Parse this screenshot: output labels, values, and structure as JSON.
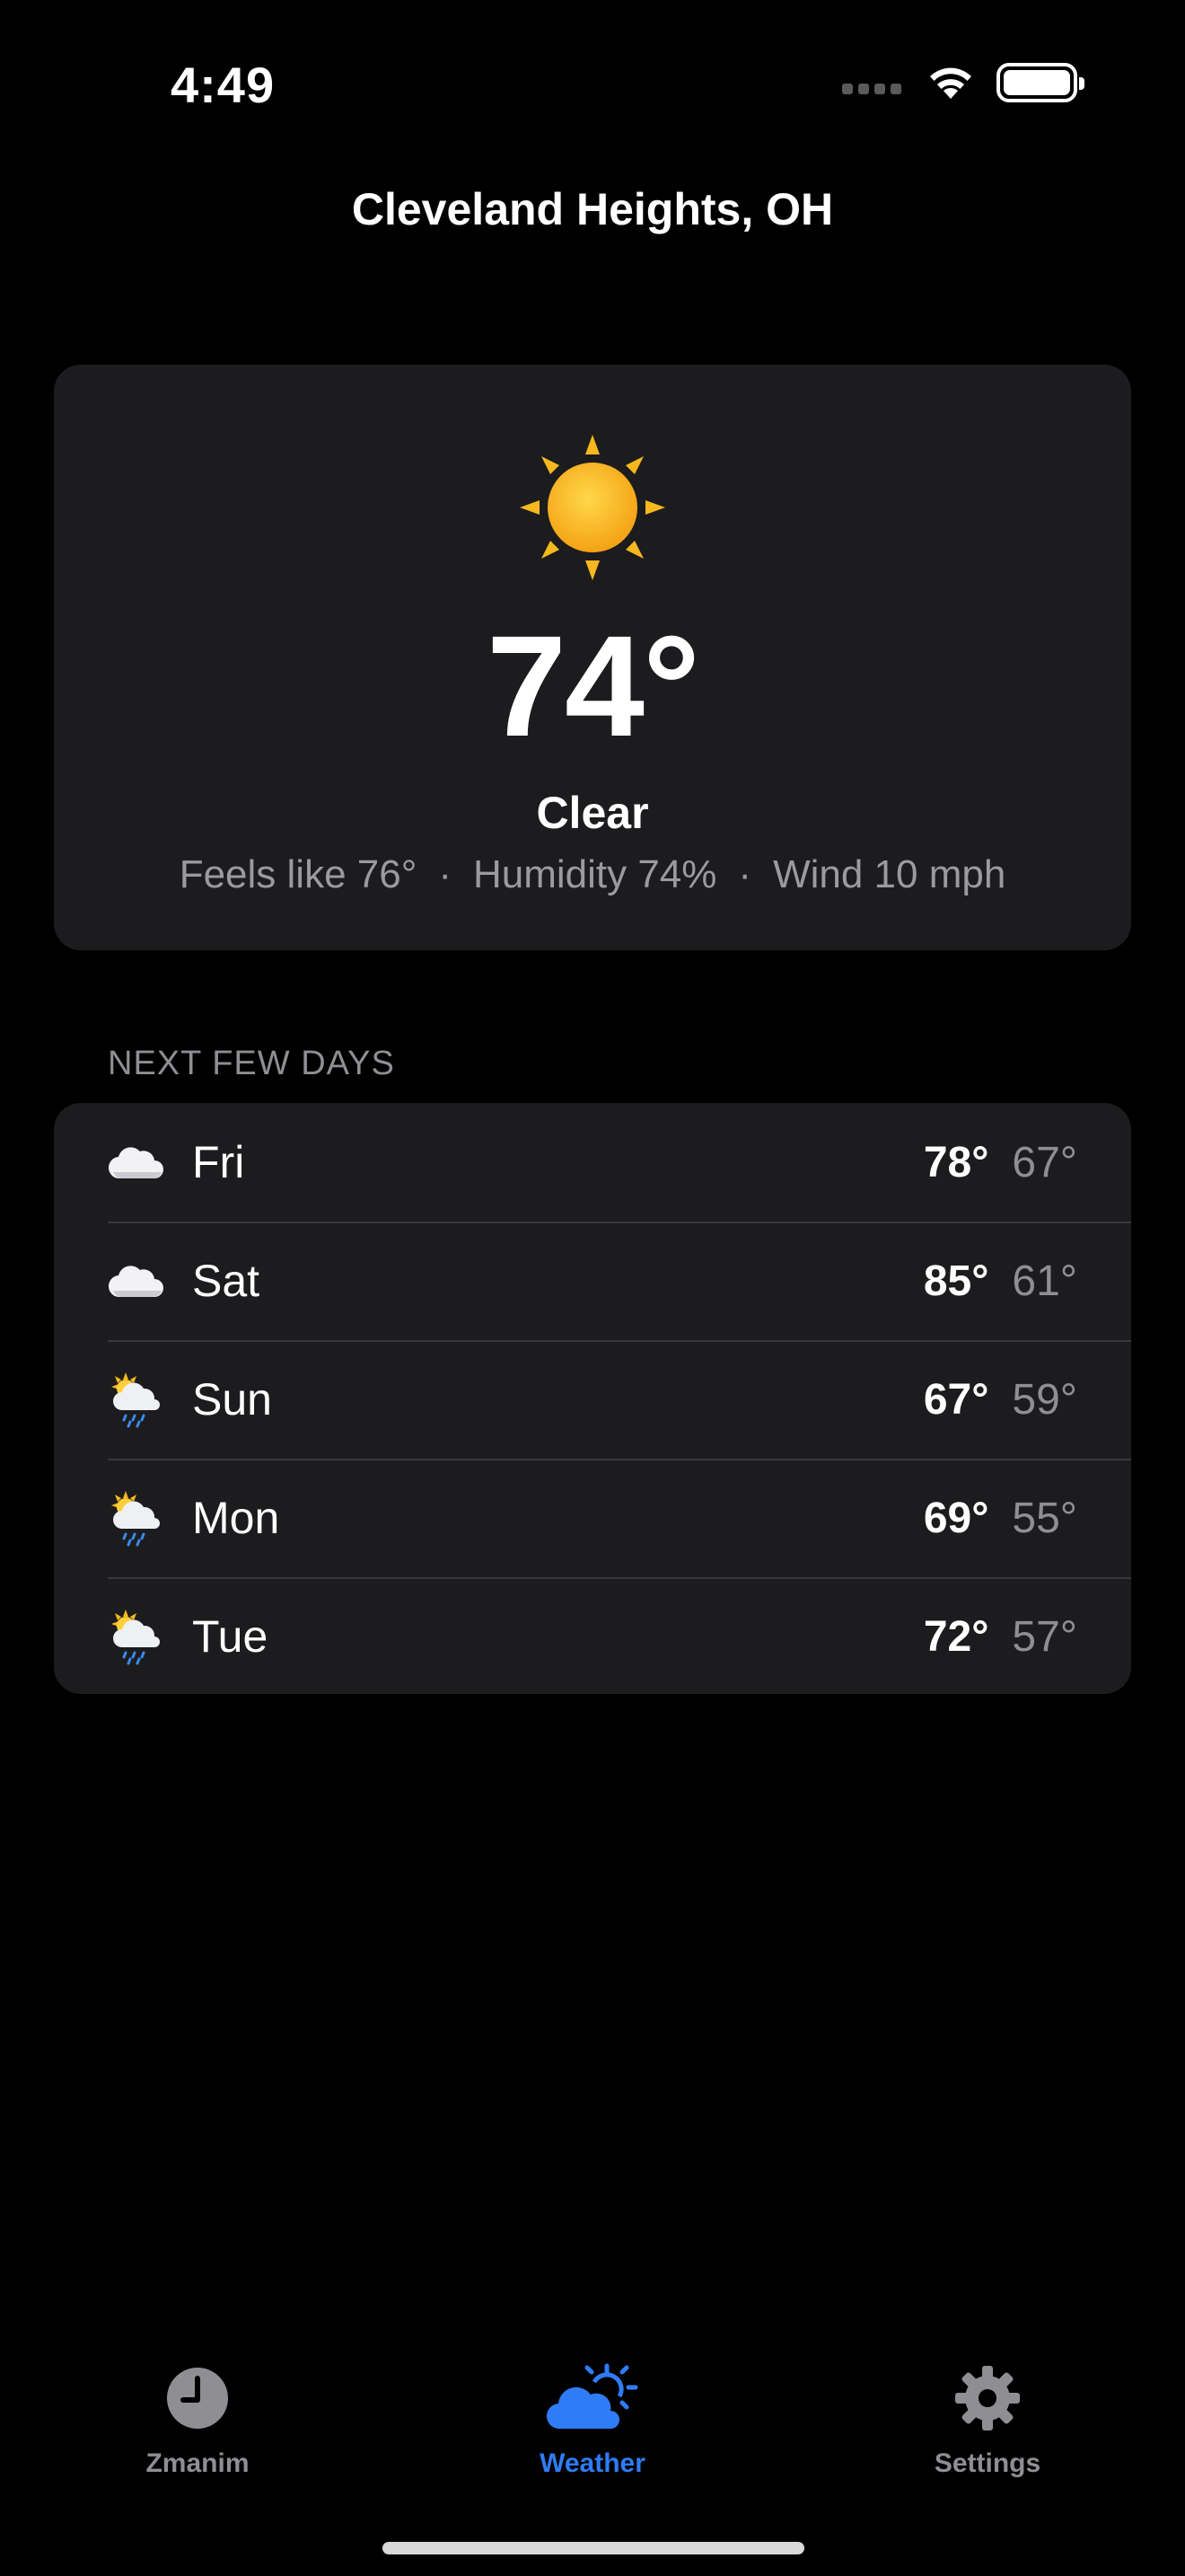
{
  "status_bar": {
    "time": "4:49",
    "icons": [
      "signal-icon",
      "wifi-icon",
      "battery-icon"
    ]
  },
  "location": "Cleveland Heights, OH",
  "current": {
    "icon": "sun-icon",
    "temperature": "74°",
    "condition": "Clear",
    "feels_like": "Feels like 76°",
    "humidity": "Humidity 74%",
    "wind": "Wind 10 mph",
    "separator": "·"
  },
  "forecast": {
    "header": "NEXT FEW DAYS",
    "days": [
      {
        "day": "Fri",
        "icon": "cloud-icon",
        "high": "78°",
        "low": "67°"
      },
      {
        "day": "Sat",
        "icon": "cloud-icon",
        "high": "85°",
        "low": "61°"
      },
      {
        "day": "Sun",
        "icon": "sun-rain-cloud-icon",
        "high": "67°",
        "low": "59°"
      },
      {
        "day": "Mon",
        "icon": "sun-rain-cloud-icon",
        "high": "69°",
        "low": "55°"
      },
      {
        "day": "Tue",
        "icon": "sun-rain-cloud-icon",
        "high": "72°",
        "low": "57°"
      }
    ]
  },
  "tab_bar": {
    "tabs": [
      {
        "label": "Zmanim",
        "icon": "clock-icon",
        "active": false
      },
      {
        "label": "Weather",
        "icon": "cloud-sun-icon",
        "active": true
      },
      {
        "label": "Settings",
        "icon": "gear-icon",
        "active": false
      }
    ]
  },
  "colors": {
    "background": "#000000",
    "card": "#1c1c1e",
    "secondary_text": "#8e8e93",
    "accent": "#2f7cf6"
  }
}
